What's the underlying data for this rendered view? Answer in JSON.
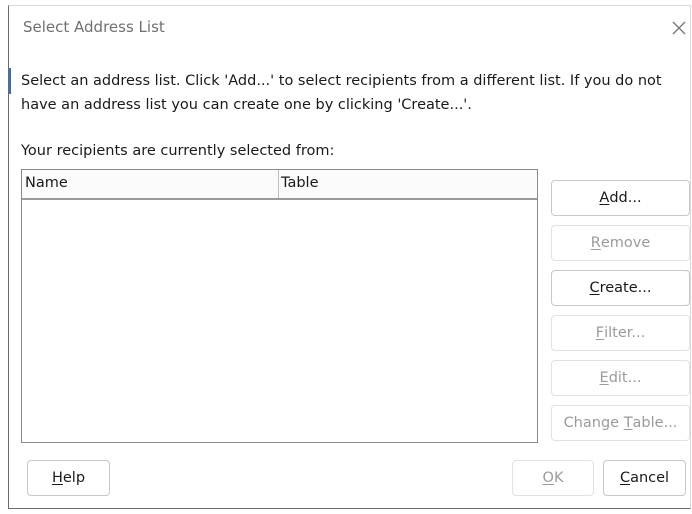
{
  "dialog": {
    "title": "Select Address List",
    "intro_text": "Select an address list. Click 'Add...' to select recipients from a different list. If you do not have an address list you can create one by clicking 'Create...'.",
    "current_label": "Your recipients are currently selected from:"
  },
  "list": {
    "columns": [
      "Name",
      "Table"
    ],
    "rows": []
  },
  "buttons": {
    "add": {
      "mnemonic": "A",
      "rest": "dd...",
      "enabled": true
    },
    "remove": {
      "mnemonic": "R",
      "rest": "emove",
      "enabled": false
    },
    "create": {
      "mnemonic": "C",
      "rest": "reate...",
      "enabled": true
    },
    "filter": {
      "mnemonic": "F",
      "rest": "ilter...",
      "enabled": false
    },
    "edit": {
      "mnemonic": "E",
      "rest": "dit...",
      "enabled": false
    },
    "change_table": {
      "prefix": "Change ",
      "mnemonic": "T",
      "rest": "able...",
      "enabled": false
    },
    "help": {
      "mnemonic": "H",
      "rest": "elp",
      "enabled": true
    },
    "ok": {
      "mnemonic": "O",
      "rest": "K",
      "enabled": false
    },
    "cancel": {
      "mnemonic": "C",
      "rest": "ancel",
      "enabled": true
    }
  },
  "icons": {
    "close": "close-icon"
  },
  "colors": {
    "focus_accent": "#3a6fb0",
    "disabled_text": "#9a9a9a"
  }
}
